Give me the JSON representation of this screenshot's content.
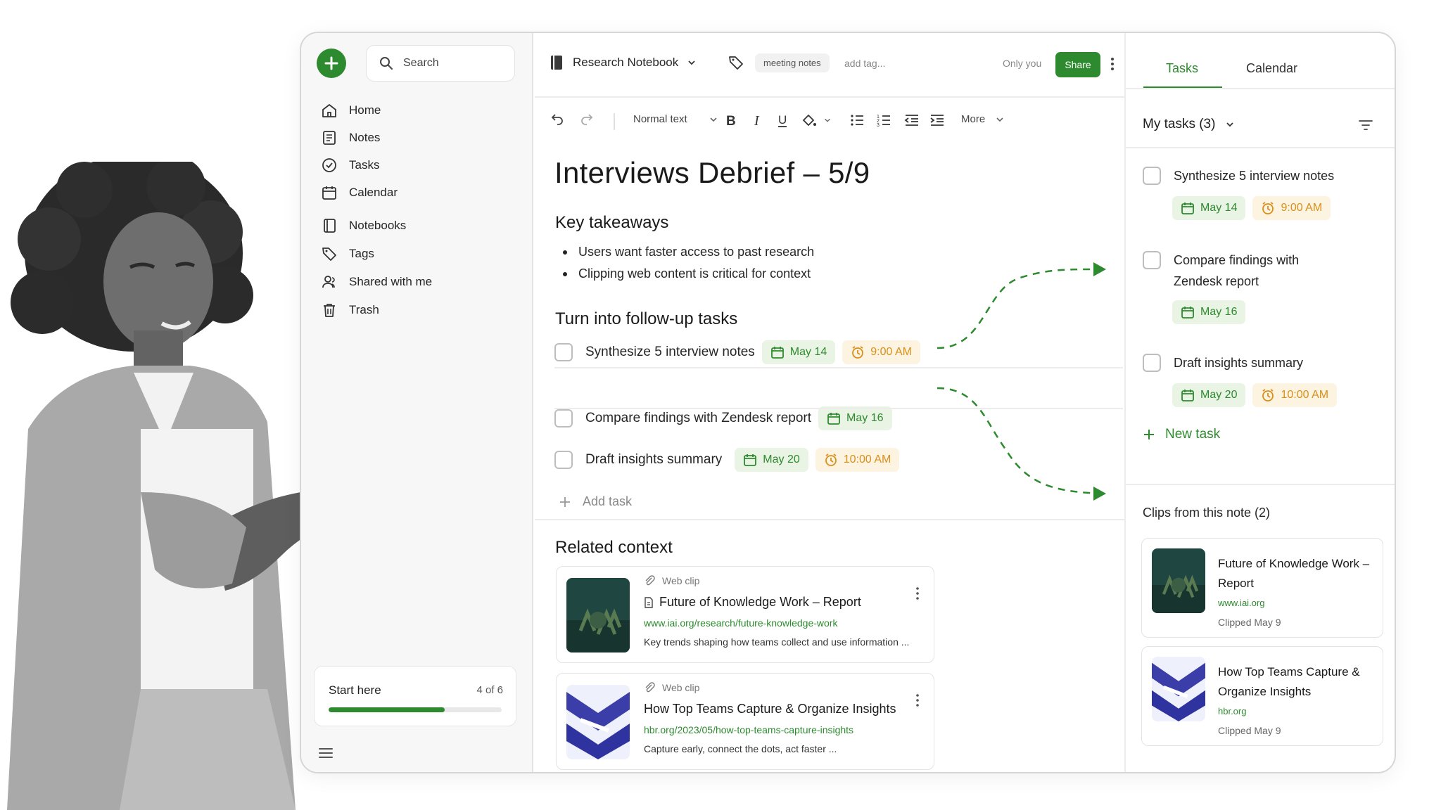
{
  "sidebar": {
    "search_placeholder": "Search",
    "nav": [
      "Home",
      "Notes",
      "Tasks",
      "Calendar",
      "Notebooks",
      "Tags",
      "Shared with me",
      "Trash"
    ],
    "start_card": {
      "title": "Start here",
      "count": "4 of 6",
      "progress": 0.67
    }
  },
  "editor": {
    "notebook": "Research Notebook",
    "tag": "meeting notes",
    "add_tag": "add tag...",
    "sharing": "Only you",
    "share_label": "Share",
    "toolbar": {
      "text_style": "Normal text",
      "more": "More"
    },
    "title": "Interviews Debrief – 5/9",
    "key_takeaways": {
      "heading": "Key takeaways",
      "bullets": [
        "Users want faster access to past research",
        "Clipping web content is critical for context"
      ]
    },
    "followups": {
      "heading": "Turn into follow-up tasks",
      "tasks": [
        {
          "label": "Synthesize 5 interview notes",
          "date": "May 14",
          "time": "9:00 AM"
        },
        {
          "label": "Compare findings with Zendesk report",
          "date": "May 16"
        },
        {
          "label": "Draft insights summary",
          "date": "May 20",
          "time": "10:00 AM"
        }
      ],
      "add_task": "Add task"
    },
    "related": {
      "heading": "Related context",
      "clips": [
        {
          "source": "Web clip",
          "title": "Future of Knowledge Work – Report",
          "url": "www.iai.org/research/future-knowledge-work",
          "desc": "Key trends shaping how teams collect and use information ..."
        },
        {
          "source": "Web clip",
          "title": "How Top Teams Capture & Organize Insights",
          "url": "hbr.org/2023/05/how-top-teams-capture-insights",
          "desc": "Capture early, connect the dots, act faster ..."
        }
      ]
    }
  },
  "right_panel": {
    "tabs": [
      "Tasks",
      "Calendar"
    ],
    "my_tasks": "My tasks (3)",
    "tasks": [
      {
        "label_lines": [
          "Synthesize 5 interview notes"
        ],
        "date": "May 14",
        "time": "9:00 AM"
      },
      {
        "label_lines": [
          "Compare findings with",
          "Zendesk report"
        ],
        "date": "May 16"
      },
      {
        "label_lines": [
          "Draft insights summary"
        ],
        "date": "May 20",
        "time": "10:00 AM"
      }
    ],
    "new_task": "New task",
    "clips_heading": "Clips from this note (2)",
    "clips": [
      {
        "title_lines": [
          "Future of Knowledge Work –",
          "Report"
        ],
        "domain": "www.iai.org",
        "clipped": "Clipped May 9"
      },
      {
        "title_lines": [
          "How Top Teams Capture &",
          "Organize Insights"
        ],
        "domain": "hbr.org",
        "clipped": "Clipped May 9"
      }
    ]
  },
  "colors": {
    "accent": "#2d8a2f",
    "accent_bg": "#eaf4e4",
    "time": "#d9901a",
    "time_bg": "#fdf3e1"
  }
}
